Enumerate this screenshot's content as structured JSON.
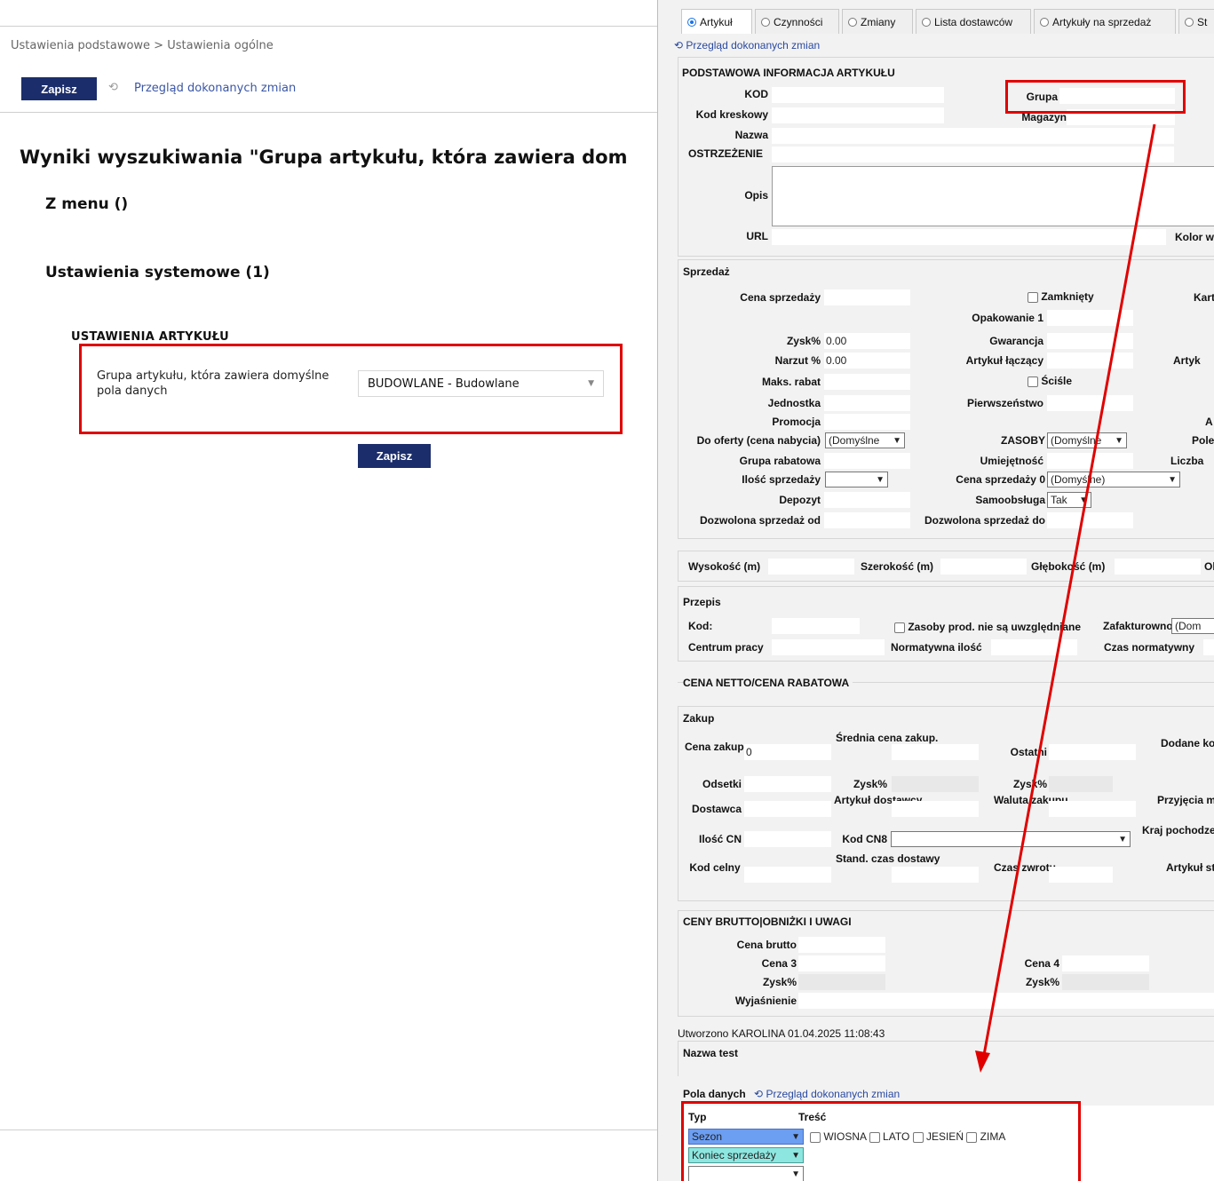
{
  "left": {
    "breadcrumb": "Ustawienia podstawowe > Ustawienia ogólne",
    "save_label": "Zapisz",
    "history_link": "Przegląd dokonanych zmian",
    "results_title": "Wyniki wyszukiwania \"Grupa artykułu, która zawiera dom",
    "from_menu": "Z menu ()",
    "system_settings": "Ustawienia systemowe (1)",
    "article_settings": "USTAWIENIA ARTYKUŁU",
    "setting_label": "Grupa artykułu, która zawiera domyślne pola danych",
    "setting_value": "BUDOWLANE - Budowlane",
    "bottom_save_label": "Zapisz"
  },
  "right": {
    "tabs": [
      "Artykuł",
      "Czynności",
      "Zmiany",
      "Lista dostawców",
      "Artykuły na sprzedaż",
      "St"
    ],
    "history_link": "Przegląd dokonanych zmian",
    "basic": {
      "title": "PODSTAWOWA INFORMACJA ARTYKUŁU",
      "kod": "KOD",
      "kod_kreskowy": "Kod kreskowy",
      "nazwa": "Nazwa",
      "ostrzezenie": "OSTRZEŻENIE",
      "opis": "Opis",
      "url": "URL",
      "grupa": "Grupa",
      "magazyn": "Magazyn",
      "kolor": "Kolor w"
    },
    "sales": {
      "title": "Sprzedaż",
      "cena_sprzedazy": "Cena sprzedaży",
      "zamkniety": "Zamknięty",
      "kart": "Kart",
      "opakowanie": "Opakowanie 1",
      "zysk": "Zysk%",
      "zysk_val": "0.00",
      "gwarancja": "Gwarancja",
      "narzut": "Narzut %",
      "narzut_val": "0.00",
      "artykul_laczacy": "Artykuł łączący",
      "artyk": "Artyk",
      "maks_rabat": "Maks. rabat",
      "scisle": "Ściśle",
      "jednostka": "Jednostka",
      "pierwszenstwo": "Pierwszeństwo",
      "promocja": "Promocja",
      "a_cut": "A",
      "do_oferty": "Do oferty (cena nabycia)",
      "do_oferty_val": "(Domyślne",
      "zasoby": "ZASOBY",
      "zasoby_val": "(Domyślne",
      "pole": "Pole",
      "grupa_rabatowa": "Grupa rabatowa",
      "umiejetnosc": "Umiejętność",
      "liczba": "Liczba",
      "ilosc_sprzedazy": "Ilość sprzedaży",
      "cena_sprzedazy_0": "Cena sprzedaży 0",
      "cena_sprzedazy_0_val": "(Domyślne)",
      "depozyt": "Depozyt",
      "samoobsluga": "Samoobsługa",
      "samoobsluga_val": "Tak",
      "dozwolona_od": "Dozwolona sprzedaż od",
      "dozwolona_do": "Dozwolona sprzedaż do"
    },
    "dims": {
      "wysokosc": "Wysokość (m)",
      "szerokosc": "Szerokość (m)",
      "glebokosc": "Głębokość (m)",
      "ob": "Ob"
    },
    "recipe": {
      "title": "Przepis",
      "kod": "Kod:",
      "zasoby_text": "Zasoby prod. nie są uwzględniane",
      "zafakturowno": "Zafakturowno",
      "zafakturowno_val": "(Dom",
      "centrum": "Centrum pracy",
      "normatywna": "Normatywna ilość",
      "czas_norm": "Czas normatywny"
    },
    "netto_title": "CENA NETTO/CENA RABATOWA",
    "purchase": {
      "title": "Zakup",
      "cena_zakupu": "Cena zakupu",
      "cena_zakupu_val": "0",
      "srednia": "Średnia cena zakup.",
      "ostatni": "Ostatni",
      "dodane": "Dodane koszty",
      "odsetki": "Odsetki",
      "zysk": "Zysk%",
      "zysk2": "Zysk%",
      "dostawca": "Dostawca",
      "artykul_dostawcy": "Artykuł dostawcy",
      "waluta": "Waluta zakupu",
      "przyjecia": "Przyjęcia magazyn.",
      "ilosc_cn": "Ilość CN",
      "kod_cn8": "Kod CN8",
      "kraj": "Kraj pochodzenia",
      "kod_celny": "Kod celny",
      "stand": "Stand. czas dostawy",
      "czas_zwrotu": "Czas zwrotu",
      "artykul_strat": "Artykuł strat"
    },
    "gross": {
      "title": "CENY BRUTTO|OBNIŻKI I UWAGI",
      "cena_brutto": "Cena brutto",
      "cena3": "Cena 3",
      "cena4": "Cena 4",
      "zysk": "Zysk%",
      "zysk2": "Zysk%",
      "wyjasnienie": "Wyjaśnienie"
    },
    "created": "Utworzono KAROLINA 01.04.2025 11:08:43",
    "nazwa_test": "Nazwa test",
    "data_fields": {
      "title": "Pola danych",
      "history_link": "Przegląd dokonanych zmian",
      "typ": "Typ",
      "tresc": "Treść",
      "row1_type": "Sezon",
      "row1_options": [
        "WIOSNA",
        "LATO",
        "JESIEŃ",
        "ZIMA"
      ],
      "row2_type": "Koniec sprzedaży",
      "row3_type": ""
    }
  },
  "colors": {
    "primary": "#1b2d6b",
    "highlight_red": "#e00000",
    "sezon_blue": "#6c9ef2",
    "koniec_teal": "#8ee6e0"
  }
}
